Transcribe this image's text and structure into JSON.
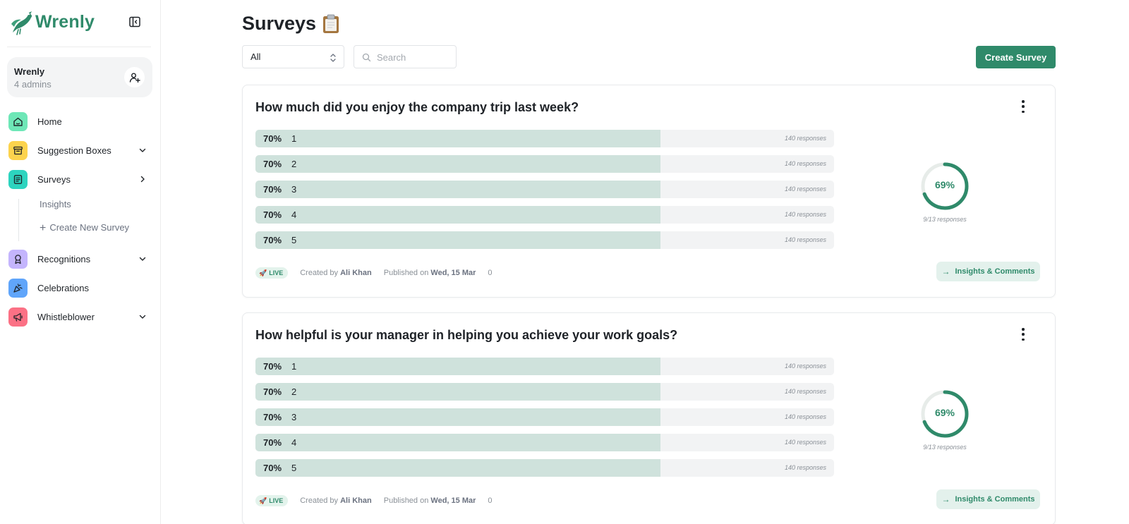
{
  "sidebar": {
    "brand": "Wrenly",
    "workspace": {
      "name": "Wrenly",
      "subtitle": "4 admins"
    },
    "nav": [
      {
        "label": "Home",
        "icon": "home-icon",
        "bg": "#6ee7b7"
      },
      {
        "label": "Suggestion Boxes",
        "icon": "archive-box-icon",
        "bg": "#fcd34d"
      },
      {
        "label": "Surveys",
        "icon": "survey-document-icon",
        "bg": "#2dd4bf"
      },
      {
        "label": "Recognitions",
        "icon": "award-ribbon-icon",
        "bg": "#c4b5fd"
      },
      {
        "label": "Celebrations",
        "icon": "party-popper-icon",
        "bg": "#60a5fa"
      },
      {
        "label": "Whistleblower",
        "icon": "megaphone-icon",
        "bg": "#fb7185"
      }
    ],
    "surveys_sub": {
      "insights": "Insights",
      "create_new": "Create New Survey"
    }
  },
  "header": {
    "title": "Surveys",
    "filter_value": "All",
    "search_placeholder": "Search",
    "create_button": "Create Survey"
  },
  "colors": {
    "accent": "#2f8a6a",
    "bar_fill": "#cfe2dc",
    "bar_track": "#f2f3f4"
  },
  "surveys": [
    {
      "question": "How much did you enjoy the company trip last week?",
      "options": [
        {
          "percent": 70,
          "percent_label": "70%",
          "label": "1",
          "responses": "140 responses"
        },
        {
          "percent": 70,
          "percent_label": "70%",
          "label": "2",
          "responses": "140 responses"
        },
        {
          "percent": 70,
          "percent_label": "70%",
          "label": "3",
          "responses": "140 responses"
        },
        {
          "percent": 70,
          "percent_label": "70%",
          "label": "4",
          "responses": "140 responses"
        },
        {
          "percent": 70,
          "percent_label": "70%",
          "label": "5",
          "responses": "140 responses"
        }
      ],
      "completion": {
        "percent": 69,
        "percent_label": "69%",
        "responses": "9/13 responses"
      },
      "status": "LIVE",
      "created_by_prefix": "Created by",
      "created_by": "Ali Khan",
      "published_prefix": "Published on",
      "published_date": "Wed, 15 Mar",
      "comments_count": "0",
      "insights_button": "Insights & Comments"
    },
    {
      "question": "How helpful is your manager in helping you achieve your work goals?",
      "options": [
        {
          "percent": 70,
          "percent_label": "70%",
          "label": "1",
          "responses": "140 responses"
        },
        {
          "percent": 70,
          "percent_label": "70%",
          "label": "2",
          "responses": "140 responses"
        },
        {
          "percent": 70,
          "percent_label": "70%",
          "label": "3",
          "responses": "140 responses"
        },
        {
          "percent": 70,
          "percent_label": "70%",
          "label": "4",
          "responses": "140 responses"
        },
        {
          "percent": 70,
          "percent_label": "70%",
          "label": "5",
          "responses": "140 responses"
        }
      ],
      "completion": {
        "percent": 69,
        "percent_label": "69%",
        "responses": "9/13 responses"
      },
      "status": "LIVE",
      "created_by_prefix": "Created by",
      "created_by": "Ali Khan",
      "published_prefix": "Published on",
      "published_date": "Wed, 15 Mar",
      "comments_count": "0",
      "insights_button": "Insights & Comments"
    }
  ]
}
